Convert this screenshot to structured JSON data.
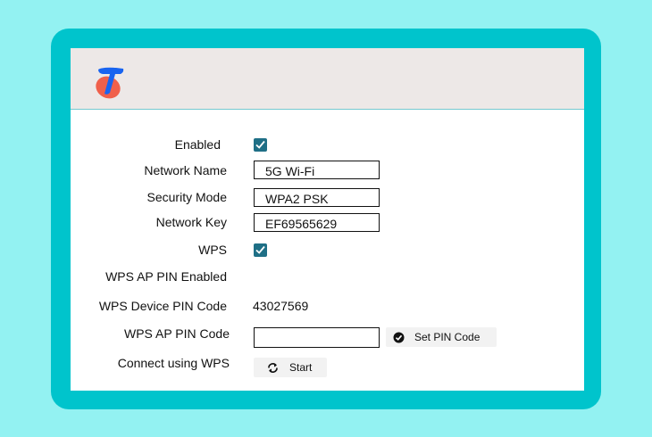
{
  "brand": {
    "logo_icon": "telstra-logo-icon",
    "logo_letter": "T"
  },
  "colors": {
    "outer_bg": "#93f2f2",
    "frame": "#00c4cc",
    "header_bg": "#ede8e7",
    "checkbox": "#1f6f86",
    "logo_blue": "#1964f0",
    "logo_orange": "#f0604b"
  },
  "form": {
    "enabled": {
      "label": "Enabled",
      "checked": true
    },
    "network_name": {
      "label": "Network Name",
      "value": "5G Wi-Fi"
    },
    "security_mode": {
      "label": "Security Mode",
      "value": "WPA2 PSK"
    },
    "network_key": {
      "label": "Network Key",
      "value": "EF69565629"
    },
    "wps": {
      "label": "WPS",
      "checked": true
    },
    "wps_ap_pin_enabled": {
      "label": "WPS AP PIN Enabled"
    },
    "wps_device_pin": {
      "label": "WPS Device PIN Code",
      "value": "43027569"
    },
    "wps_ap_pin": {
      "label": "WPS AP PIN Code",
      "value": "",
      "button_label": "Set PIN Code",
      "button_icon": "check-circle-icon"
    },
    "connect_wps": {
      "label": "Connect using WPS",
      "button_label": "Start",
      "button_icon": "refresh-icon"
    }
  }
}
